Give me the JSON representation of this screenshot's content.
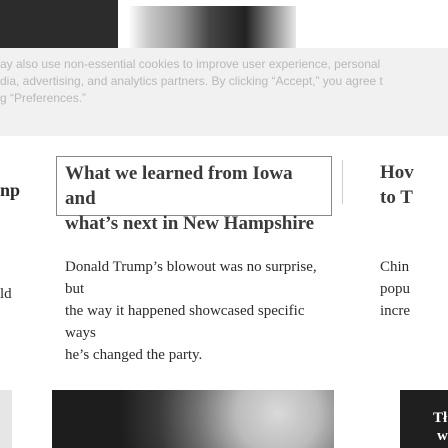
{
  "cookie_banner": {
    "lines": [
      "ay also use non-essential cookies to improve user experience, personal",
      "dia, advertising, and analytics partners. By clicking “Accept,” you agree t",
      "g “Preferences.”"
    ],
    "preferences_link": "Preferences"
  },
  "card_left": {
    "headline_fragment": "np",
    "desc_fragment": "ld"
  },
  "card_main": {
    "headline_line1": "What we learned from Iowa and",
    "headline_line2": "what’s next in New Hampshire",
    "description_line1": "Donald Trump’s blowout was no surprise, but",
    "description_line2": "the way it happened showcased specific ways",
    "description_line3": "he’s changed the party."
  },
  "card_right": {
    "headline_line1": "Hov",
    "headline_line2": "to T",
    "description_line1": "Chin",
    "description_line2": "popu",
    "description_line3": "incre",
    "image_text_1": "Tł",
    "image_text_2": "w"
  },
  "colors": {
    "banner_bg": "#f1f1f1",
    "banner_text": "#b8b8b8",
    "headline_text": "#3a3a3a",
    "body_text": "#2c2c2c",
    "border": "#888888"
  }
}
